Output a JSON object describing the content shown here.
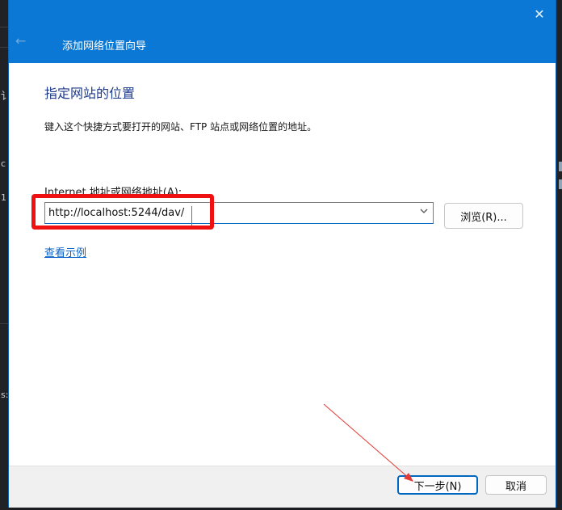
{
  "window": {
    "close_glyph": "✕",
    "back_glyph": "←",
    "title": "添加网络位置向导"
  },
  "page": {
    "heading": "指定网站的位置",
    "instruction": "键入这个快捷方式要打开的网站、FTP 站点或网络位置的地址。",
    "address_label": "Internet 地址或网络地址(A):",
    "address_value": "http://localhost:5244/dav/",
    "browse_label": "浏览(R)...",
    "example_link": "查看示例"
  },
  "footer": {
    "next_label": "下一步(N)",
    "cancel_label": "取消"
  },
  "background": {
    "left_glyphs": [
      "讠",
      "c",
      "1",
      "s:"
    ]
  },
  "colors": {
    "titlebar": "#0a78d4",
    "heading": "#1e3a8a",
    "link": "#0a63c8",
    "highlight": "#ef1111",
    "accent_border": "#0067c0"
  },
  "icons": {
    "close": "close-icon",
    "back": "back-arrow-icon",
    "dropdown": "chevron-down-icon"
  }
}
